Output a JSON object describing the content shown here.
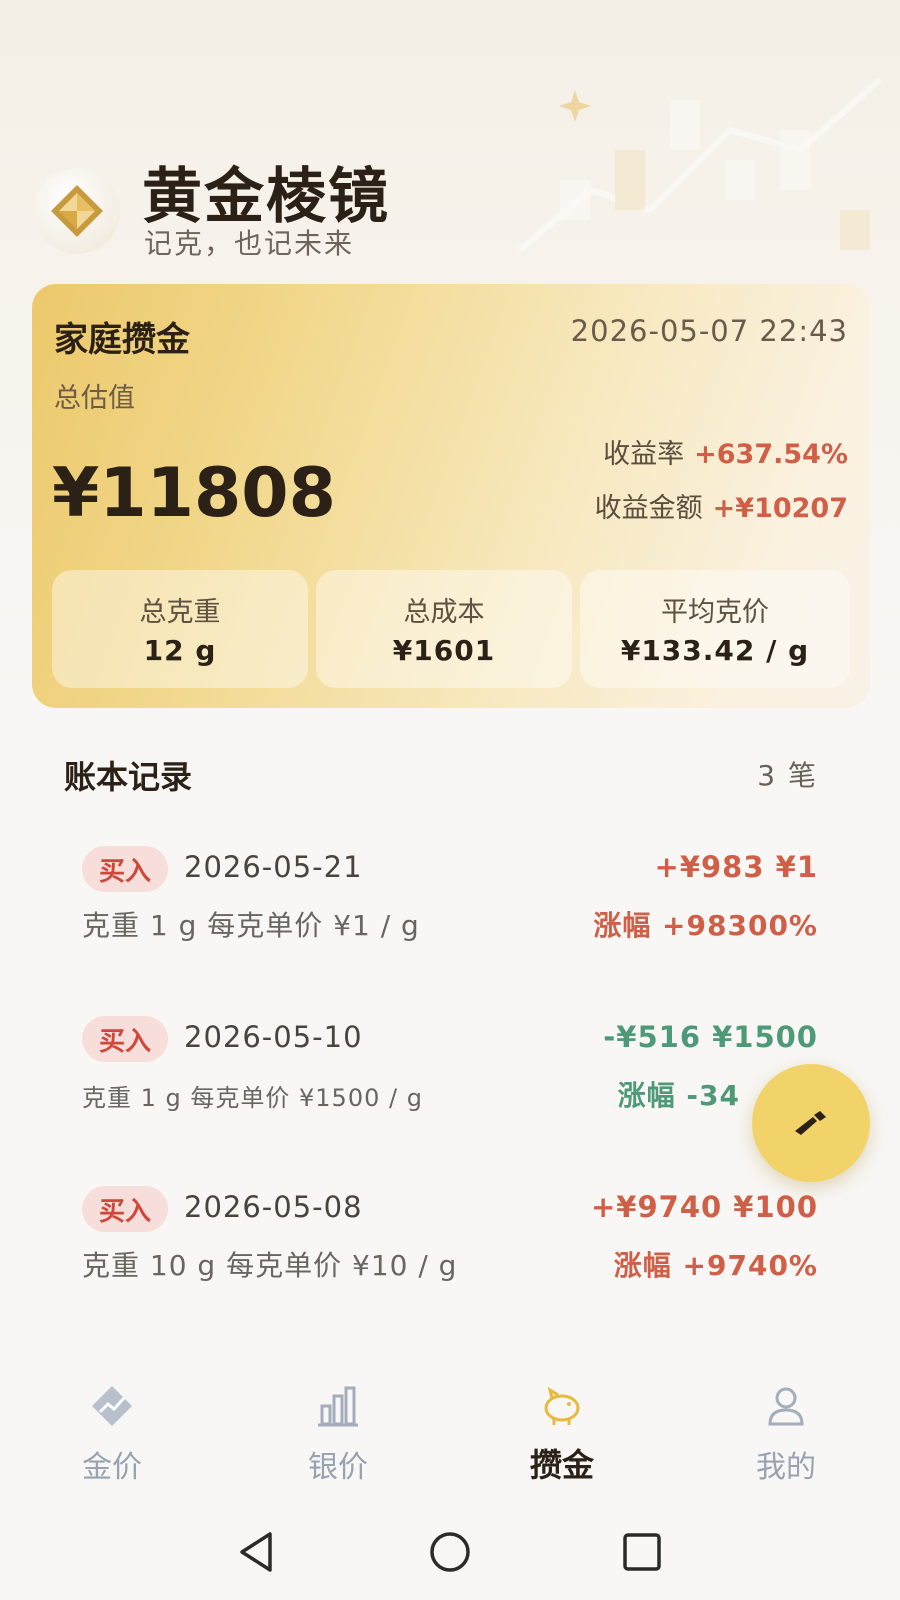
{
  "app": {
    "title": "黄金棱镜",
    "subtitle": "记克，也记未来"
  },
  "colors": {
    "accent_gold": "#f2d36a",
    "gain_red": "#d05f48",
    "loss_green": "#4e9a78",
    "tag_bg": "#f7dedb"
  },
  "summary": {
    "name": "家庭攒金",
    "timestamp": "2026-05-07 22:43",
    "total_label": "总估值",
    "total_value": "¥11808",
    "rate_label": "收益率",
    "rate_value": "+637.54%",
    "profit_label": "收益金额",
    "profit_value": "+¥10207",
    "stats": [
      {
        "label": "总克重",
        "value": "12 g"
      },
      {
        "label": "总成本",
        "value": "¥1601"
      },
      {
        "label": "平均克价",
        "value": "¥133.42 / g"
      }
    ]
  },
  "ledger": {
    "title": "账本记录",
    "count": "3 笔",
    "records": [
      {
        "type": "买入",
        "date": "2026-05-21",
        "detail": "克重 1 g  每克单价 ¥1 / g",
        "top_right": "+¥983  ¥1",
        "change": "涨幅 +98300%",
        "trend": "up"
      },
      {
        "type": "买入",
        "date": "2026-05-10",
        "detail": "克重 1 g  每克单价 ¥1500 / g",
        "top_right": "-¥516  ¥1500",
        "change": "涨幅 -34",
        "trend": "down"
      },
      {
        "type": "买入",
        "date": "2026-05-08",
        "detail": "克重 10 g  每克单价 ¥10 / g",
        "top_right": "+¥9740  ¥100",
        "change": "涨幅 +9740%",
        "trend": "up"
      }
    ]
  },
  "fab": {
    "icon": "edit-pencil-icon"
  },
  "tabs": [
    {
      "label": "金价",
      "icon": "gold-chart-icon",
      "active": false
    },
    {
      "label": "银价",
      "icon": "bar-chart-icon",
      "active": false
    },
    {
      "label": "攒金",
      "icon": "piggy-bank-icon",
      "active": true
    },
    {
      "label": "我的",
      "icon": "user-icon",
      "active": false
    }
  ],
  "system_nav": [
    "back-triangle-icon",
    "home-circle-icon",
    "recents-square-icon"
  ]
}
